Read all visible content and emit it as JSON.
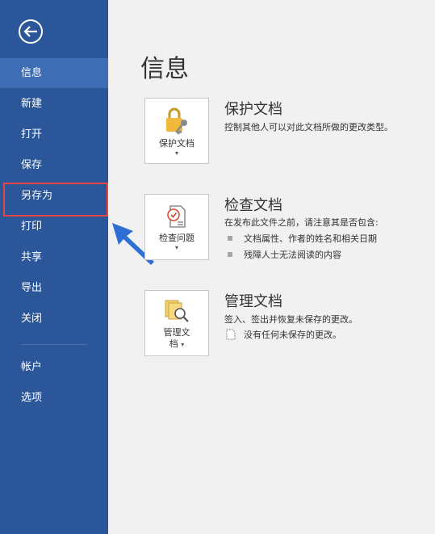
{
  "sidebar": {
    "items": [
      {
        "label": "信息"
      },
      {
        "label": "新建"
      },
      {
        "label": "打开"
      },
      {
        "label": "保存"
      },
      {
        "label": "另存为"
      },
      {
        "label": "打印"
      },
      {
        "label": "共享"
      },
      {
        "label": "导出"
      },
      {
        "label": "关闭"
      },
      {
        "label": "帐户"
      },
      {
        "label": "选项"
      }
    ]
  },
  "main": {
    "title": "信息",
    "sections": [
      {
        "button_label": "保护文档",
        "title": "保护文档",
        "description": "控制其他人可以对此文档所做的更改类型。",
        "bullets": []
      },
      {
        "button_label": "检查问题",
        "title": "检查文档",
        "description": "在发布此文件之前，请注意其是否包含:",
        "bullets": [
          "文档属性、作者的姓名和相关日期",
          "残障人士无法阅读的内容"
        ]
      },
      {
        "button_label_line1": "管理文",
        "button_label_line2": "档",
        "title": "管理文档",
        "description": "签入、签出并恢复未保存的更改。",
        "bullets": [
          "没有任何未保存的更改。"
        ]
      }
    ]
  },
  "colors": {
    "sidebar": "#2b579a",
    "active": "#3e6db5",
    "highlight": "#e64545",
    "arrow": "#2e6fd6"
  }
}
